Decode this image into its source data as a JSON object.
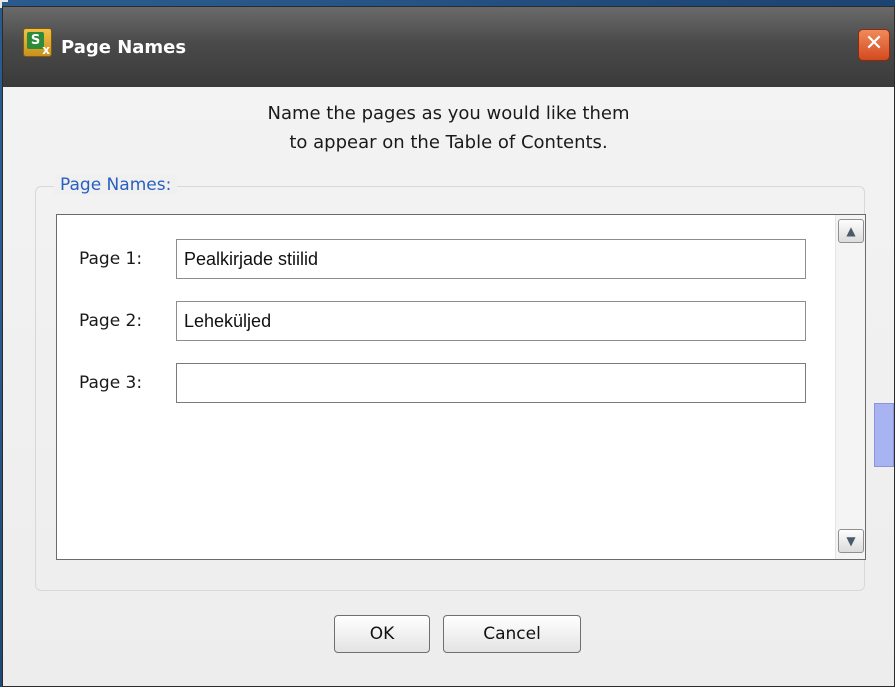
{
  "dialog": {
    "title": "Page Names",
    "close_glyph": "✕",
    "app_icon": {
      "name": "app-icon",
      "letter": "S",
      "mark": "x"
    },
    "instruction_line1": "Name the pages as you would like them",
    "instruction_line2": "to appear on the Table of Contents.",
    "group_label": "Page Names:",
    "rows": [
      {
        "label": "Page 1:",
        "value": "Pealkirjade stiilid"
      },
      {
        "label": "Page 2:",
        "value": "Leheküljed"
      },
      {
        "label": "Page 3:",
        "value": ""
      }
    ],
    "scroll_up_glyph": "▲",
    "scroll_down_glyph": "▼",
    "ok_label": "OK",
    "cancel_label": "Cancel"
  },
  "colors": {
    "titlebar": "#4a4a4a",
    "close_button": "#d4491f",
    "group_label": "#2a5fbf",
    "side_tab": "#a8b4f2"
  },
  "icons": [
    "app-icon",
    "close-icon",
    "scroll-up-icon",
    "scroll-down-icon"
  ]
}
